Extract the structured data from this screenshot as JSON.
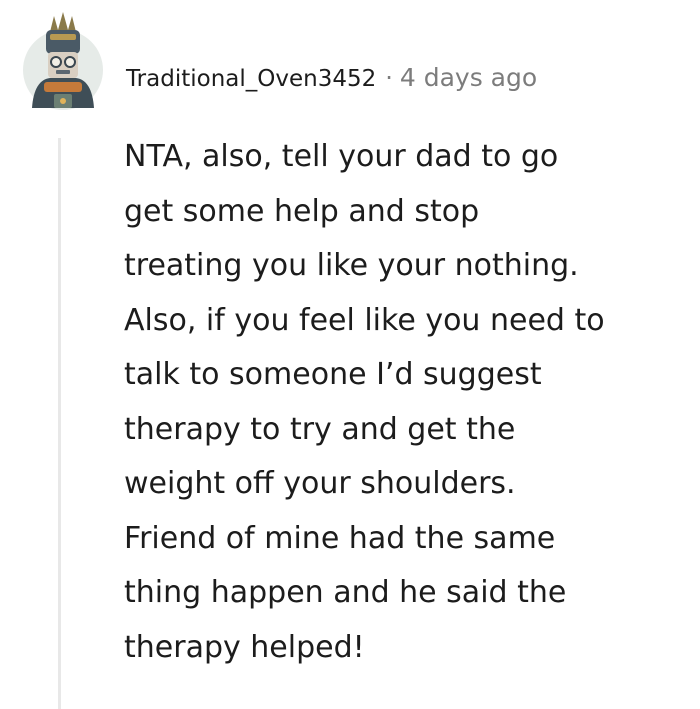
{
  "comment": {
    "author": "Traditional_Oven3452",
    "separator": "·",
    "timestamp": "4 days ago",
    "avatar_icon": "robot-knight-avatar",
    "thread_line_color": "#e8e8e8",
    "body_lines": [
      "NTA, also, tell your dad to go",
      "get some help and stop",
      "treating you like your nothing.",
      "Also, if you feel like you need to",
      "talk to someone I’d suggest",
      "therapy to try and get the",
      "weight off your shoulders.",
      "Friend of mine had the same",
      "thing happen and he said the",
      "therapy helped!"
    ]
  }
}
